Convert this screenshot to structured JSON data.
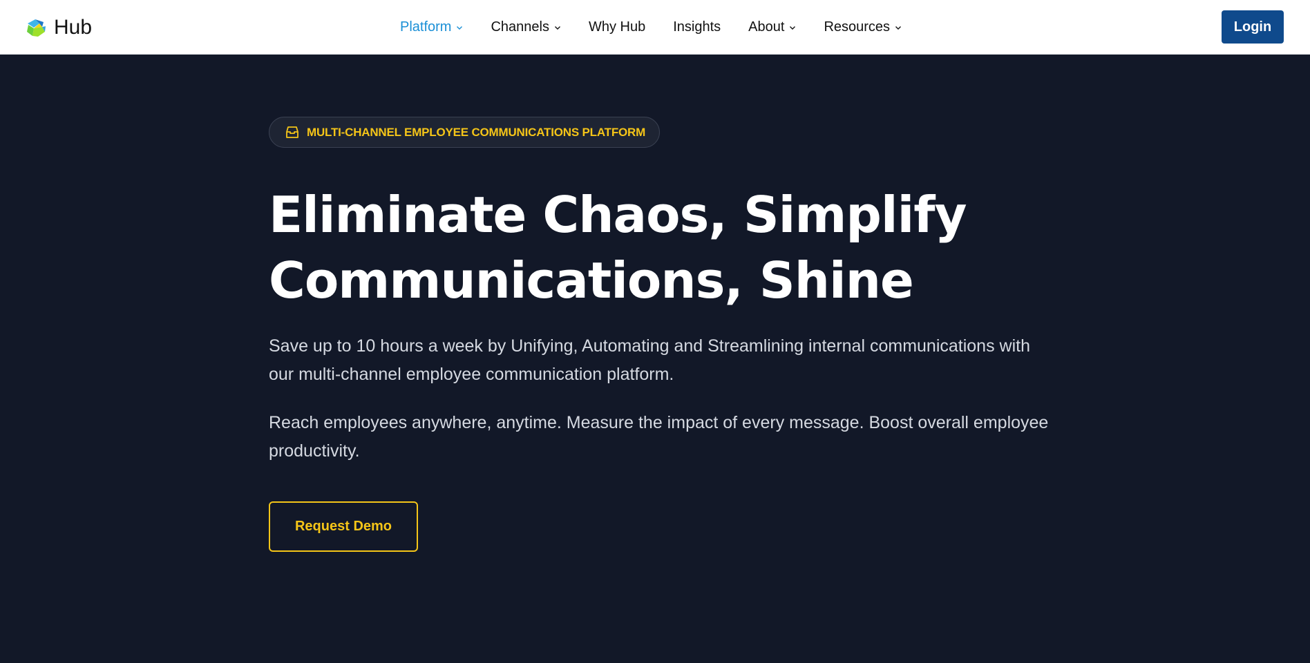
{
  "header": {
    "brand": {
      "name": "Hub",
      "logo_icon": "hub-logo-icon"
    },
    "nav": [
      {
        "label": "Platform",
        "dropdown": true,
        "active": true
      },
      {
        "label": "Channels",
        "dropdown": true,
        "active": false
      },
      {
        "label": "Why Hub",
        "dropdown": false,
        "active": false
      },
      {
        "label": "Insights",
        "dropdown": false,
        "active": false
      },
      {
        "label": "About",
        "dropdown": true,
        "active": false
      },
      {
        "label": "Resources",
        "dropdown": true,
        "active": false
      }
    ],
    "login_label": "Login"
  },
  "hero": {
    "badge": {
      "icon": "inbox-tray-icon",
      "text": "MULTI-CHANNEL EMPLOYEE COMMUNICATIONS PLATFORM"
    },
    "headline_line1": "Eliminate Chaos, Simplify",
    "headline_line2": "Communications, Shine",
    "paragraph1": "Save up to 10 hours a week by Unifying, Automating and Streamlining internal communications with our multi-channel employee communication platform.",
    "paragraph2": "Reach employees anywhere, anytime. Measure the impact of every message. Boost overall employee productivity.",
    "cta_label": "Request Demo"
  },
  "colors": {
    "hero_background": "#121828",
    "accent_yellow": "#f5c518",
    "nav_active": "#1a8fd6",
    "login_button": "#0f4a8c",
    "header_background": "#ffffff"
  }
}
